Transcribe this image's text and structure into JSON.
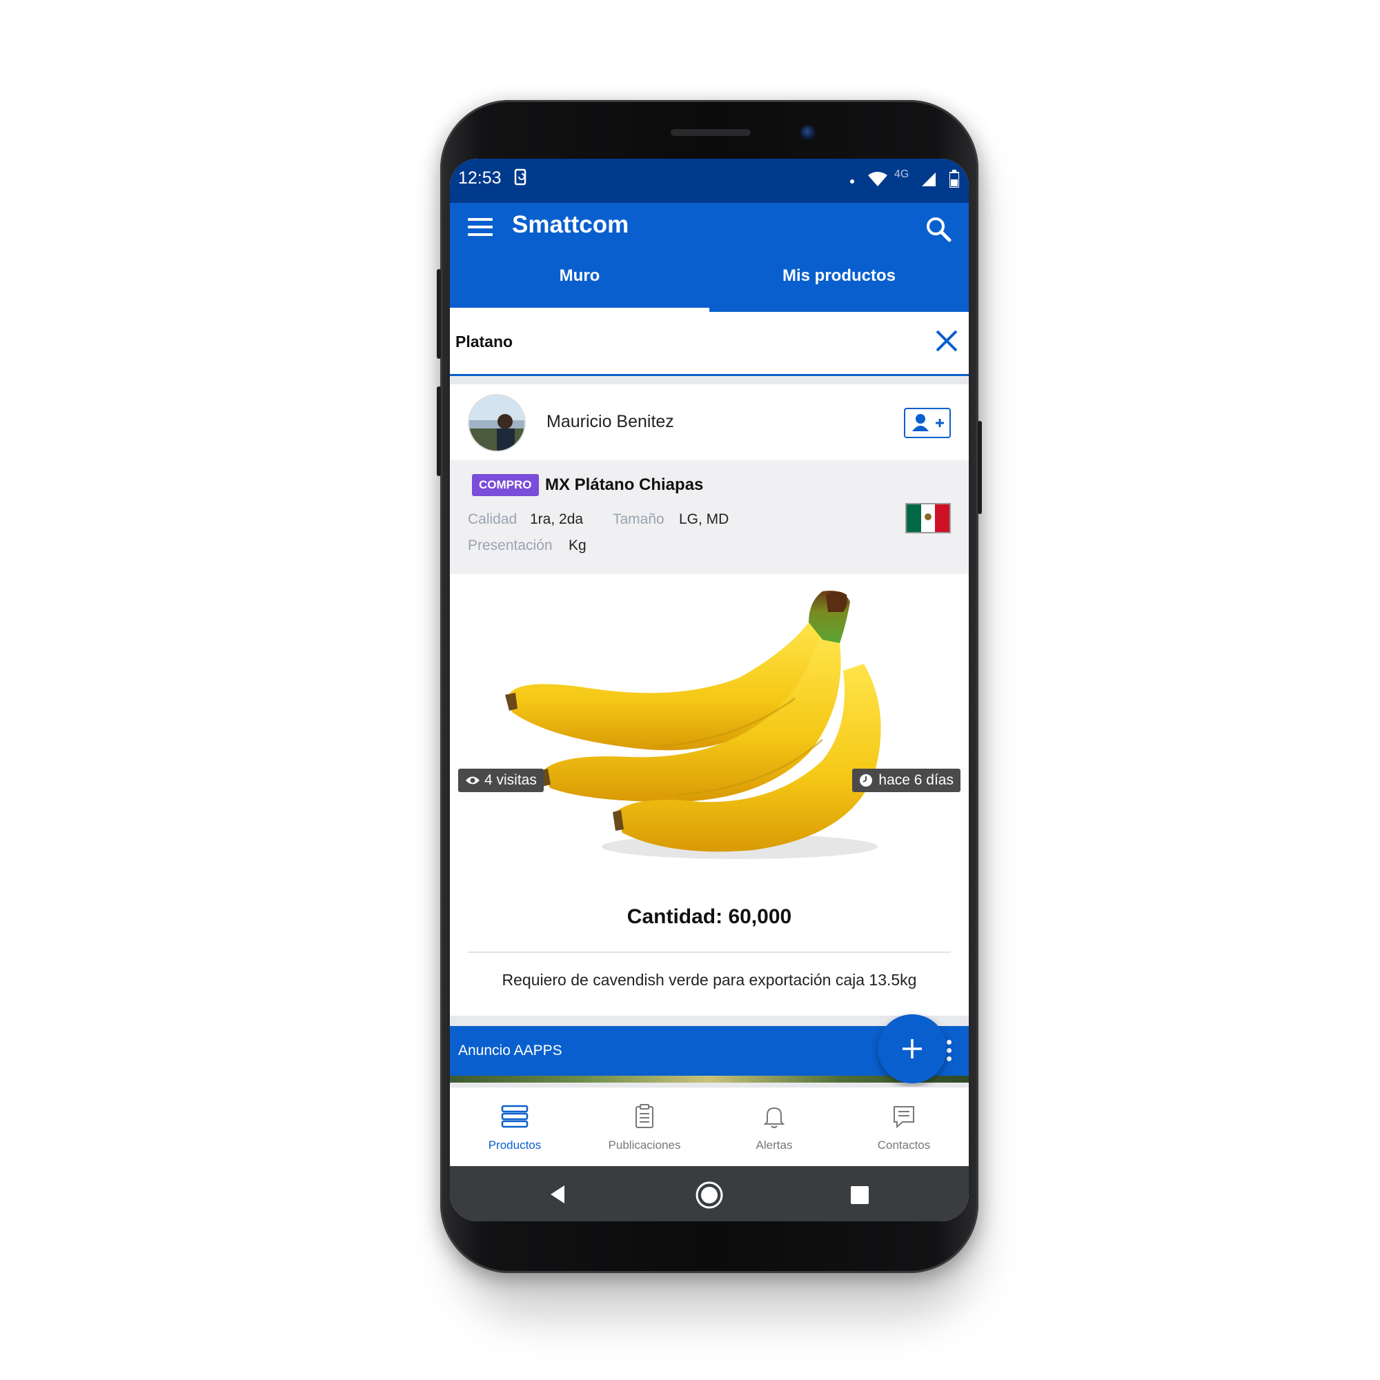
{
  "status_bar": {
    "time": "12:53",
    "network_label": "4G"
  },
  "app_bar": {
    "title": "Smattcom"
  },
  "tabs": [
    {
      "label": "Muro",
      "active": true
    },
    {
      "label": "Mis productos",
      "active": false
    }
  ],
  "search": {
    "value": "Platano"
  },
  "post": {
    "user_name": "Mauricio Benitez",
    "badge": "COMPRO",
    "product_title": "MX Plátano Chiapas",
    "attributes": {
      "calidad_label": "Calidad",
      "calidad_value": "1ra, 2da",
      "tamano_label": "Tamaño",
      "tamano_value": "LG, MD",
      "presentacion_label": "Presentación",
      "presentacion_value": "Kg"
    },
    "views": "4 visitas",
    "time_ago": "hace 6 días",
    "quantity": "Cantidad: 60,000",
    "description": "Requiero de cavendish verde para exportación caja 13.5kg"
  },
  "ad": {
    "label": "Anuncio AAPPS"
  },
  "bottom_nav": [
    {
      "label": "Productos",
      "icon": "layers-icon",
      "active": true
    },
    {
      "label": "Publicaciones",
      "icon": "clipboard-icon",
      "active": false
    },
    {
      "label": "Alertas",
      "icon": "bell-icon",
      "active": false
    },
    {
      "label": "Contactos",
      "icon": "chat-icon",
      "active": false
    }
  ],
  "colors": {
    "primary": "#0a5fce",
    "status_bar": "#003a8c",
    "badge": "#7a4ddb",
    "flag_green": "#006847",
    "flag_red": "#ce1126"
  }
}
